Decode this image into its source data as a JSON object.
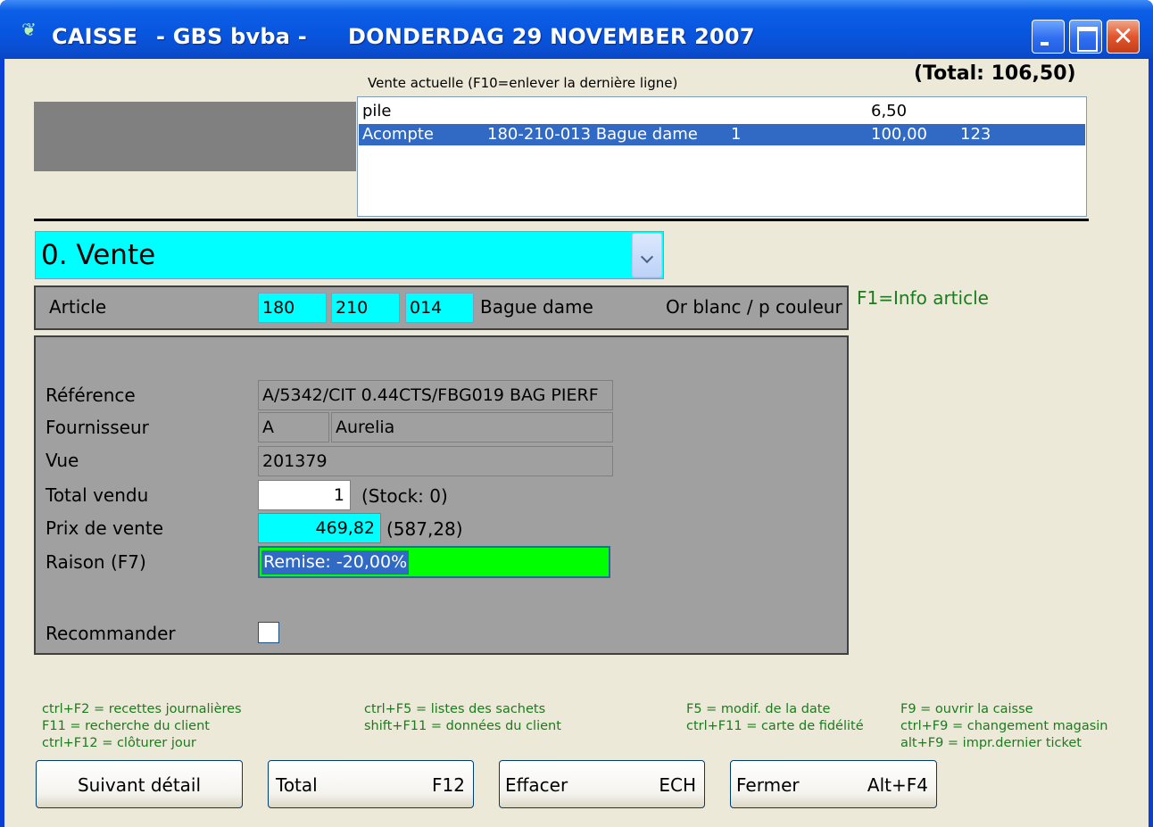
{
  "window": {
    "title_app": "CAISSE",
    "title_company": "- GBS bvba -",
    "title_date": "DONDERDAG 29 NOVEMBER 2007"
  },
  "sale": {
    "total_label": "(Total: 106,50)",
    "caption": "Vente actuelle (F10=enlever la dernière ligne)",
    "lines": [
      {
        "type": "pile",
        "description": "",
        "qty": "",
        "amount": "6,50",
        "code": "",
        "selected": false
      },
      {
        "type": "Acompte",
        "description": "180-210-013 Bague dame",
        "qty": "1",
        "amount": "100,00",
        "code": "123",
        "selected": true
      }
    ]
  },
  "mode_select": {
    "value": "0. Vente"
  },
  "article": {
    "label": "Article",
    "code1": "180",
    "code2": "210",
    "code3": "014",
    "name": "Bague dame",
    "variant": "Or blanc / p couleur",
    "info_hint": "F1=Info article"
  },
  "details": {
    "reference_label": "Référence",
    "reference_value": "A/5342/CIT  0.44CTS/FBG019 BAG PIERF",
    "supplier_label": "Fournisseur",
    "supplier_code": "A",
    "supplier_name": "Aurelia",
    "view_label": "Vue",
    "view_value": "201379",
    "total_sold_label": "Total vendu",
    "total_sold_value": "1",
    "stock_text": "(Stock: 0)",
    "price_label": "Prix de vente",
    "price_value": "469,82",
    "price_original": "(587,28)",
    "reason_label": "Raison (F7)",
    "reason_value": "Remise: -20,00%",
    "recommend_label": "Recommander",
    "recommend_checked": false
  },
  "shortcuts": {
    "col1": [
      "ctrl+F2 = recettes journalières",
      "F11 = recherche du client",
      "ctrl+F12 = clôturer jour"
    ],
    "col2": [
      "ctrl+F5 = listes des sachets",
      "shift+F11 = données du client"
    ],
    "col3": [
      "F5 = modif. de la date",
      "ctrl+F11 = carte de fidélité"
    ],
    "col4": [
      "F9 = ouvrir la caisse",
      "ctrl+F9 = changement magasin",
      "alt+F9 = impr.dernier ticket"
    ]
  },
  "buttons": {
    "next_detail": "Suivant détail",
    "total": "Total",
    "total_key": "F12",
    "erase": "Effacer",
    "erase_key": "ECH",
    "close": "Fermer",
    "close_key": "Alt+F4"
  },
  "colors": {
    "titlebar": "#0856e0",
    "face": "#ece9d8",
    "input_cyan": "#00ffff",
    "reason_green": "#00ff00",
    "selection": "#316ac5",
    "hint_green": "#1e7a1e",
    "panel_grey": "#a0a0a0"
  }
}
